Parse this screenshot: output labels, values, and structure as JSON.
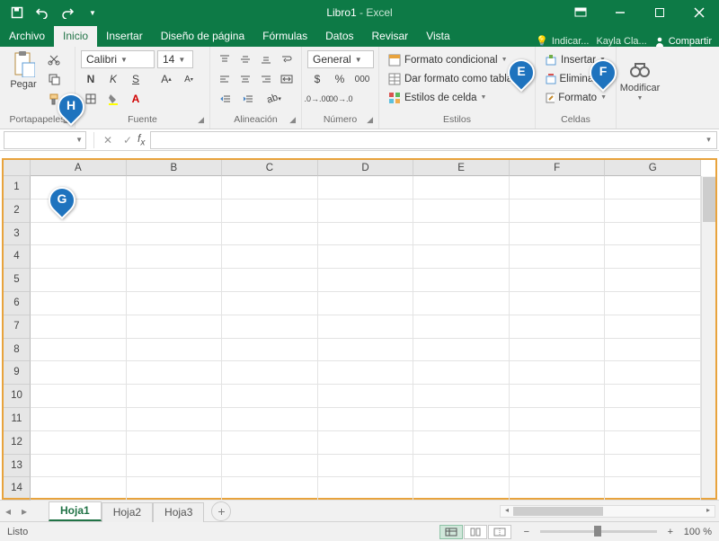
{
  "title": {
    "doc": "Libro1",
    "sep": "  -  ",
    "app": "Excel"
  },
  "tabs": [
    "Archivo",
    "Inicio",
    "Insertar",
    "Diseño de página",
    "Fórmulas",
    "Datos",
    "Revisar",
    "Vista"
  ],
  "active_tab": 1,
  "tellme": "Indicar...",
  "username": "Kayla Cla...",
  "share": "Compartir",
  "ribbon": {
    "clipboard": {
      "label": "Portapapeles",
      "paste": "Pegar"
    },
    "font": {
      "label": "Fuente",
      "name": "Calibri",
      "size": "14",
      "bold": "N",
      "italic": "K",
      "underline": "S"
    },
    "alignment": {
      "label": "Alineación"
    },
    "number": {
      "label": "Número",
      "format": "General"
    },
    "styles": {
      "label": "Estilos",
      "cond": "Formato condicional",
      "table": "Dar formato como tabla",
      "cell": "Estilos de celda"
    },
    "cells": {
      "label": "Celdas",
      "insert": "Insertar",
      "delete": "Eliminar",
      "format": "Formato"
    },
    "editing": {
      "label": "Modificar"
    }
  },
  "grid": {
    "columns": [
      "A",
      "B",
      "C",
      "D",
      "E",
      "F",
      "G"
    ],
    "rows": [
      "1",
      "2",
      "3",
      "4",
      "5",
      "6",
      "7",
      "8",
      "9",
      "10",
      "11",
      "12",
      "13",
      "14"
    ]
  },
  "sheets": [
    "Hoja1",
    "Hoja2",
    "Hoja3"
  ],
  "active_sheet": 0,
  "status": "Listo",
  "zoom": "100 %",
  "pins": {
    "E": "E",
    "F": "F",
    "G": "G",
    "H": "H"
  }
}
